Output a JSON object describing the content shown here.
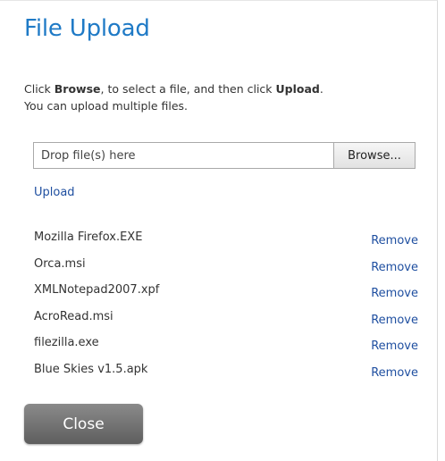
{
  "dialog": {
    "title": "File Upload",
    "instructions": {
      "part1": "Click ",
      "browse_word": "Browse",
      "part2": ", to select a file, and then click ",
      "upload_word": "Upload",
      "part3": ".",
      "line2": "You can upload multiple files."
    },
    "drop_zone": {
      "placeholder": "Drop file(s) here",
      "browse_label": "Browse..."
    },
    "upload_label": "Upload",
    "files": [
      {
        "name": "Mozilla Firefox.EXE",
        "remove_label": "Remove"
      },
      {
        "name": "Orca.msi",
        "remove_label": "Remove"
      },
      {
        "name": "XMLNotepad2007.xpf",
        "remove_label": "Remove"
      },
      {
        "name": "AcroRead.msi",
        "remove_label": "Remove"
      },
      {
        "name": "filezilla.exe",
        "remove_label": "Remove"
      },
      {
        "name": "Blue Skies v1.5.apk",
        "remove_label": "Remove"
      }
    ],
    "close_label": "Close"
  },
  "colors": {
    "title": "#1f7ac6",
    "link": "#1f4fa0",
    "close_button": "#6f6f6f"
  }
}
